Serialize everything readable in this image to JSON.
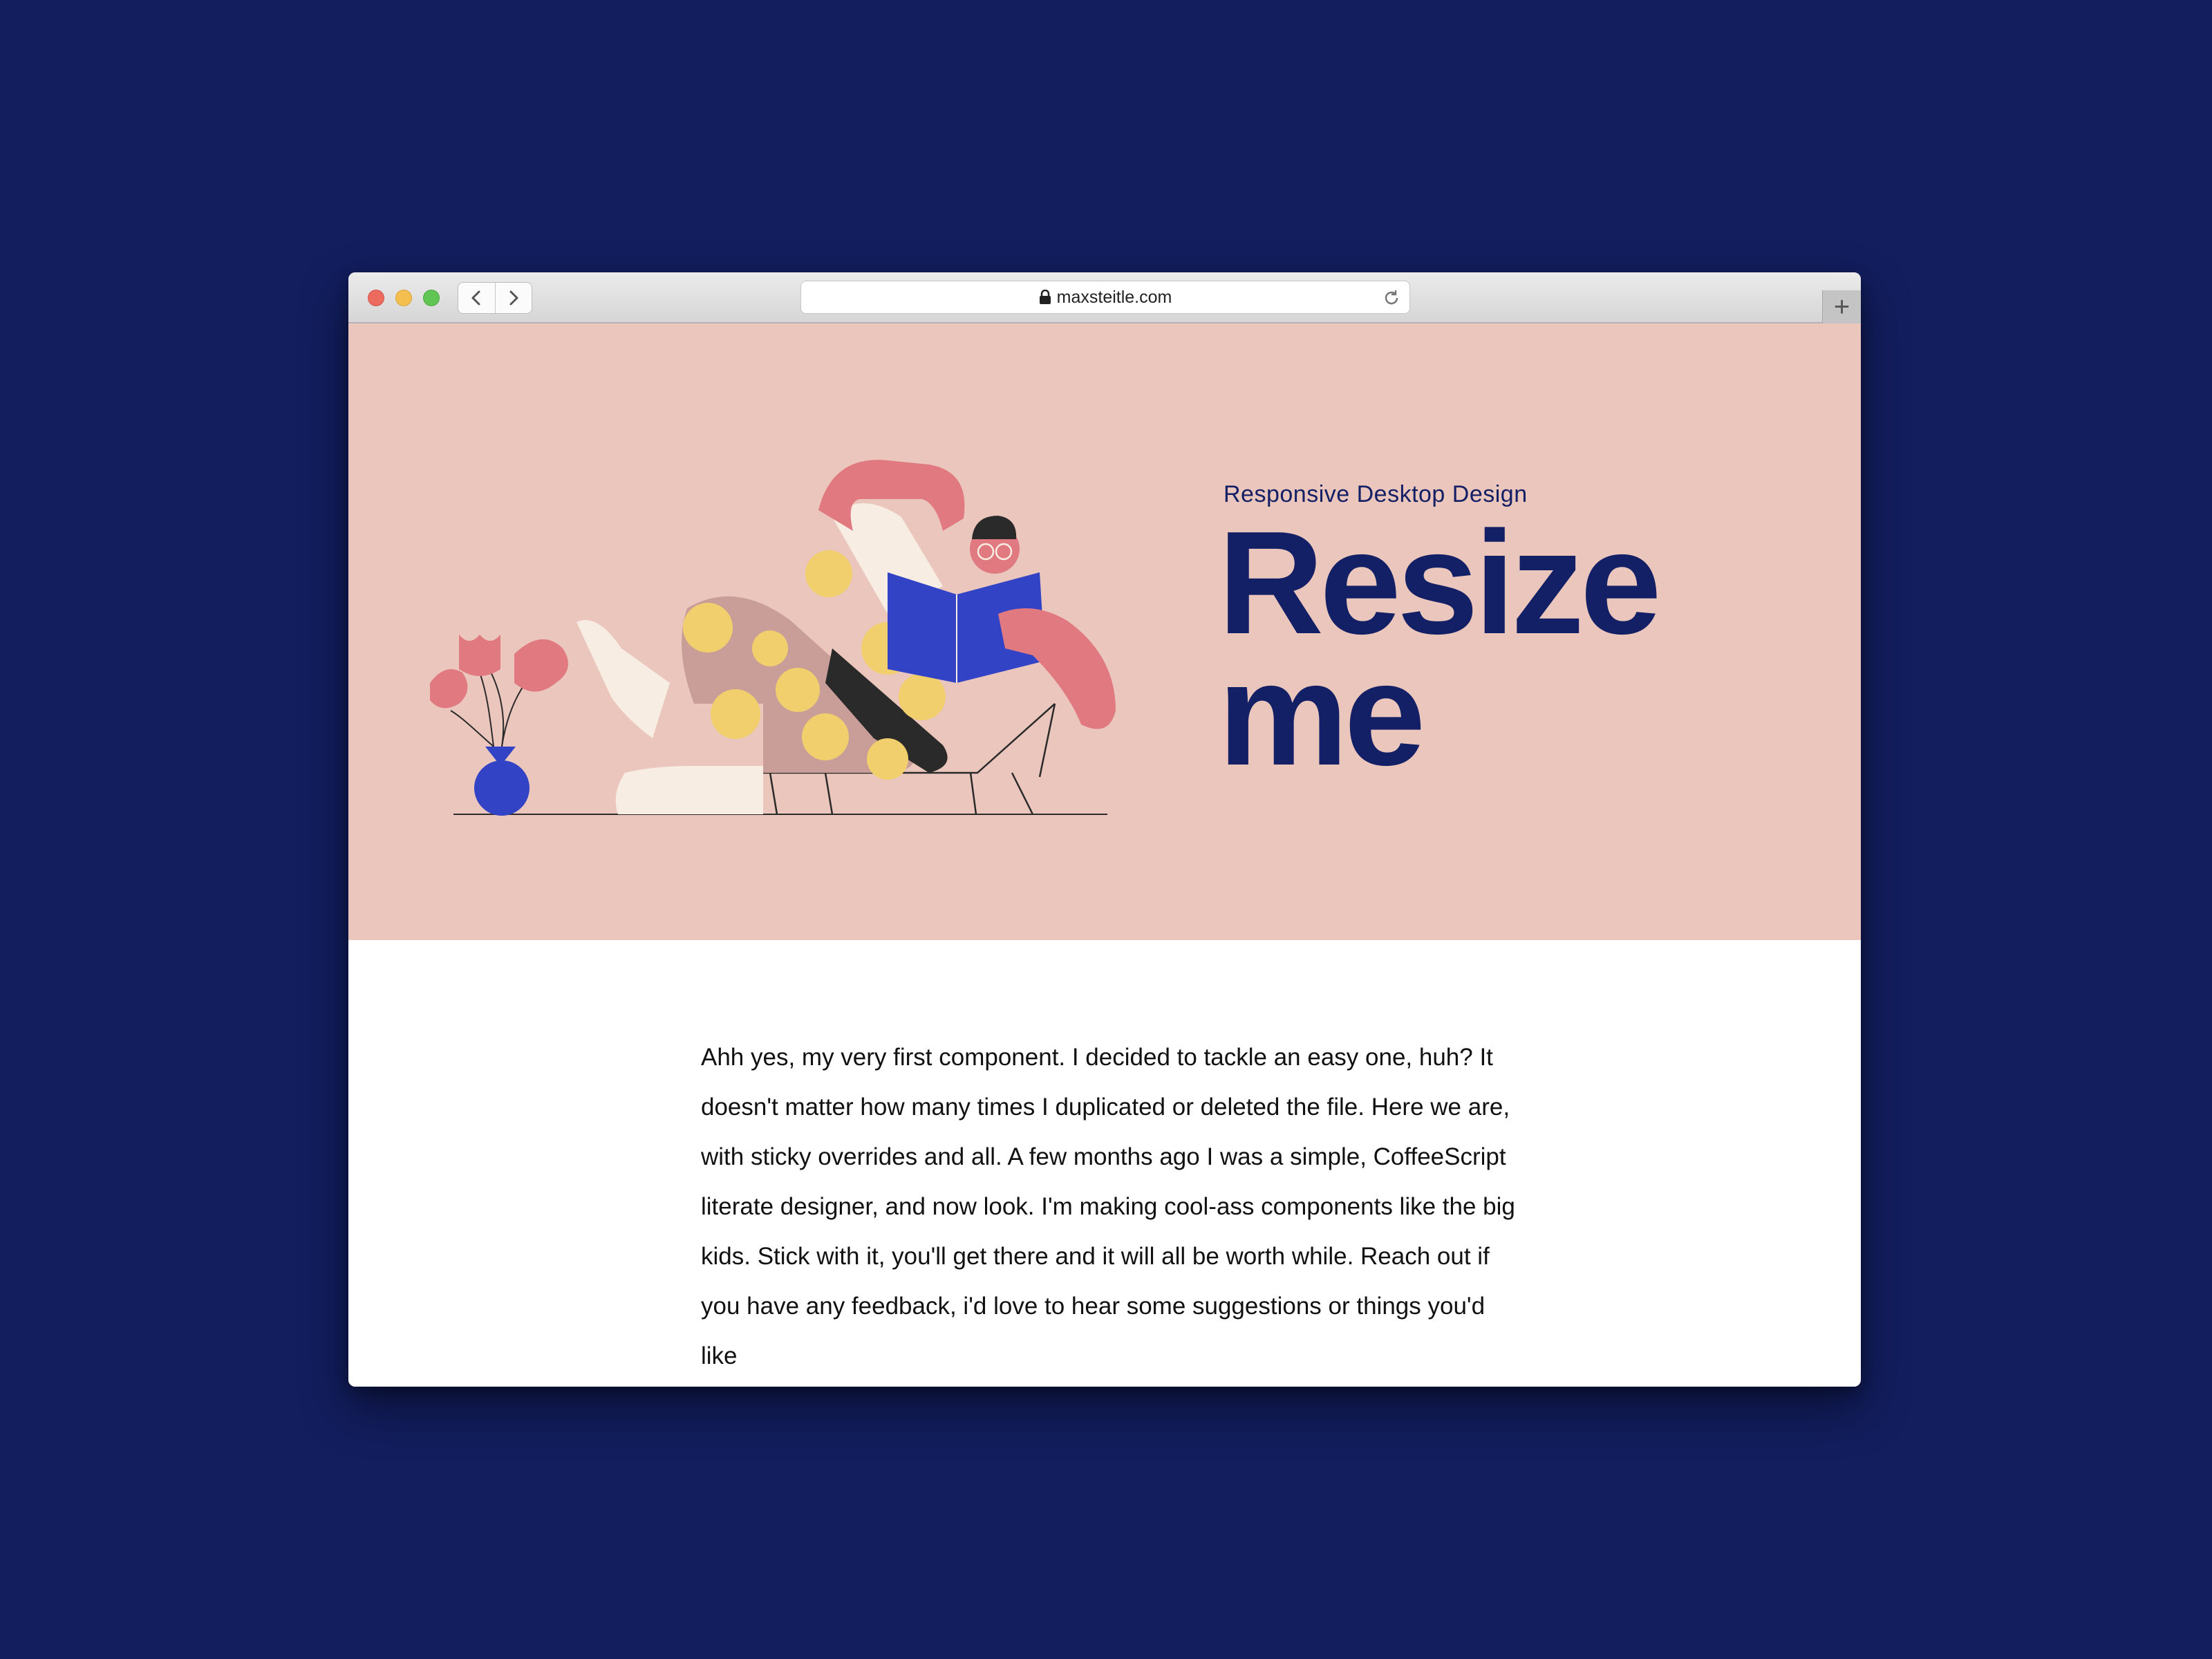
{
  "browser": {
    "url": "maxsteitle.com",
    "new_tab_label": "+"
  },
  "hero": {
    "subtitle": "Responsive Desktop Design",
    "headline_line1": "Resize",
    "headline_line2": "me"
  },
  "article": {
    "body": "Ahh yes, my very first component. I decided to tackle an easy one, huh? It doesn't matter how many times I duplicated or deleted the file. Here we are, with sticky overrides and all. A few months ago I was a simple, CoffeeScript literate designer, and now look. I'm making cool-ass components like the big kids. Stick with it, you'll get there and it will all be worth while. Reach out if you have any feedback, i'd love to hear some suggestions or things you'd like"
  },
  "colors": {
    "background": "#121e5e",
    "hero_bg": "#ebc6bd",
    "headline": "#142065",
    "accent_blue": "#3243c5",
    "accent_pink": "#e07a80",
    "accent_yellow": "#f0cf6c"
  }
}
